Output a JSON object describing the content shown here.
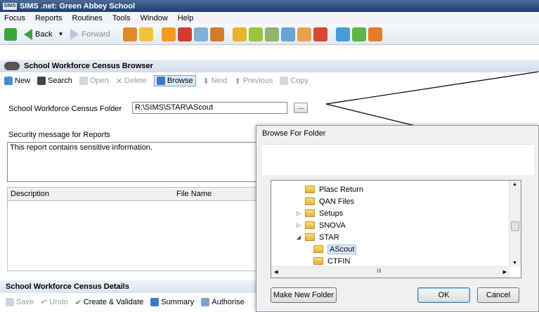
{
  "window": {
    "app_badge": "SIMS",
    "title": "SIMS .net: Green Abbey School"
  },
  "menu": [
    "Focus",
    "Reports",
    "Routines",
    "Tools",
    "Window",
    "Help"
  ],
  "nav": {
    "back_label": "Back",
    "forward_label": "Forward"
  },
  "browser": {
    "title": "School Workforce Census Browser",
    "toolbar": {
      "new": "New",
      "search": "Search",
      "open": "Open",
      "delete": "Delete",
      "browse": "Browse",
      "next": "Next",
      "previous": "Previous",
      "copy": "Copy"
    }
  },
  "form": {
    "folder_label": "School Workforce Census Folder",
    "folder_value": "R:\\SIMS\\STAR\\AScout",
    "browse_dots": "...",
    "security_label": "Security message for Reports",
    "security_value": "This report contains sensitive information."
  },
  "grid": {
    "columns": [
      "Description",
      "File Name"
    ]
  },
  "details": {
    "title": "School Workforce Census Details",
    "save": "Save",
    "undo": "Undo",
    "create_validate": "Create & Validate",
    "summary": "Summary",
    "authorise": "Authorise"
  },
  "dialog": {
    "title": "Browse For Folder",
    "tree": [
      {
        "name": "Plasc Return",
        "indent": 0,
        "expander": ""
      },
      {
        "name": "QAN Files",
        "indent": 0,
        "expander": ""
      },
      {
        "name": "Setups",
        "indent": 0,
        "expander": "▷"
      },
      {
        "name": "SNOVA",
        "indent": 0,
        "expander": "▷"
      },
      {
        "name": "STAR",
        "indent": 0,
        "expander": "◢"
      },
      {
        "name": "AScout",
        "indent": 1,
        "expander": "",
        "selected": true
      },
      {
        "name": "CTFIN",
        "indent": 1,
        "expander": ""
      }
    ],
    "hscroll_grip": "III",
    "make_new_folder": "Make New Folder",
    "ok": "OK",
    "cancel": "Cancel"
  }
}
